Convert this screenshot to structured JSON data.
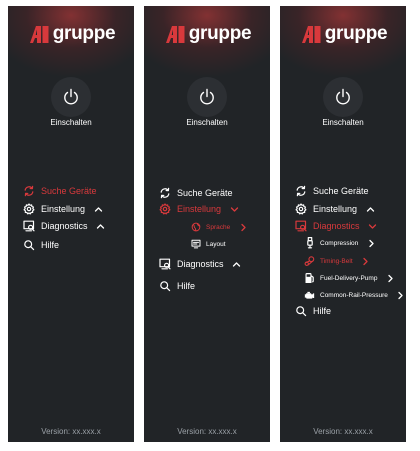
{
  "colors": {
    "panel_bg": "#212427",
    "accent": "#d8393c",
    "text": "#ffffff",
    "muted": "#9aa0a6"
  },
  "brand": {
    "name": "gruppe",
    "mark": "AI"
  },
  "power": {
    "label": "Einschalten"
  },
  "version": "Version: xx.xxx.x",
  "panels": [
    {
      "state": "collapsed",
      "items": [
        {
          "label": "Suche Geräte",
          "icon": "refresh-icon",
          "active": true
        },
        {
          "label": "Einstellung",
          "icon": "gear-icon",
          "chevron": "up"
        },
        {
          "label": "Diagnostics",
          "icon": "diagnostics-icon",
          "chevron": "up"
        },
        {
          "label": "Hilfe",
          "icon": "search-icon"
        }
      ]
    },
    {
      "state": "settings-expanded",
      "items": [
        {
          "label": "Suche Geräte",
          "icon": "refresh-icon"
        },
        {
          "label": "Einstellung",
          "icon": "gear-icon",
          "chevron": "down",
          "active": true
        },
        {
          "label": "Sprache",
          "icon": "globe-icon",
          "chevron": "right",
          "active": true,
          "sub": true
        },
        {
          "label": "Layout",
          "icon": "layout-icon",
          "sub": true
        },
        {
          "label": "Diagnostics",
          "icon": "diagnostics-icon",
          "chevron": "up"
        },
        {
          "label": "Hilfe",
          "icon": "search-icon"
        }
      ]
    },
    {
      "state": "diagnostics-expanded",
      "items": [
        {
          "label": "Suche Geräte",
          "icon": "refresh-icon"
        },
        {
          "label": "Einstellung",
          "icon": "gear-icon",
          "chevron": "up"
        },
        {
          "label": "Diagnostics",
          "icon": "diagnostics-icon",
          "chevron": "down",
          "active": true
        },
        {
          "label": "Compression",
          "icon": "sparkplug-icon",
          "chevron": "right",
          "sub": true
        },
        {
          "label": "Timing-Belt",
          "icon": "belt-icon",
          "chevron": "right",
          "sub": true,
          "active": true
        },
        {
          "label": "Fuel-Delivery-Pump",
          "icon": "fuel-pump-icon",
          "chevron": "right",
          "sub": true
        },
        {
          "label": "Common-Rail-Pressure",
          "icon": "engine-icon",
          "chevron": "right",
          "sub": true
        },
        {
          "label": "Hilfe",
          "icon": "search-icon"
        }
      ]
    }
  ]
}
